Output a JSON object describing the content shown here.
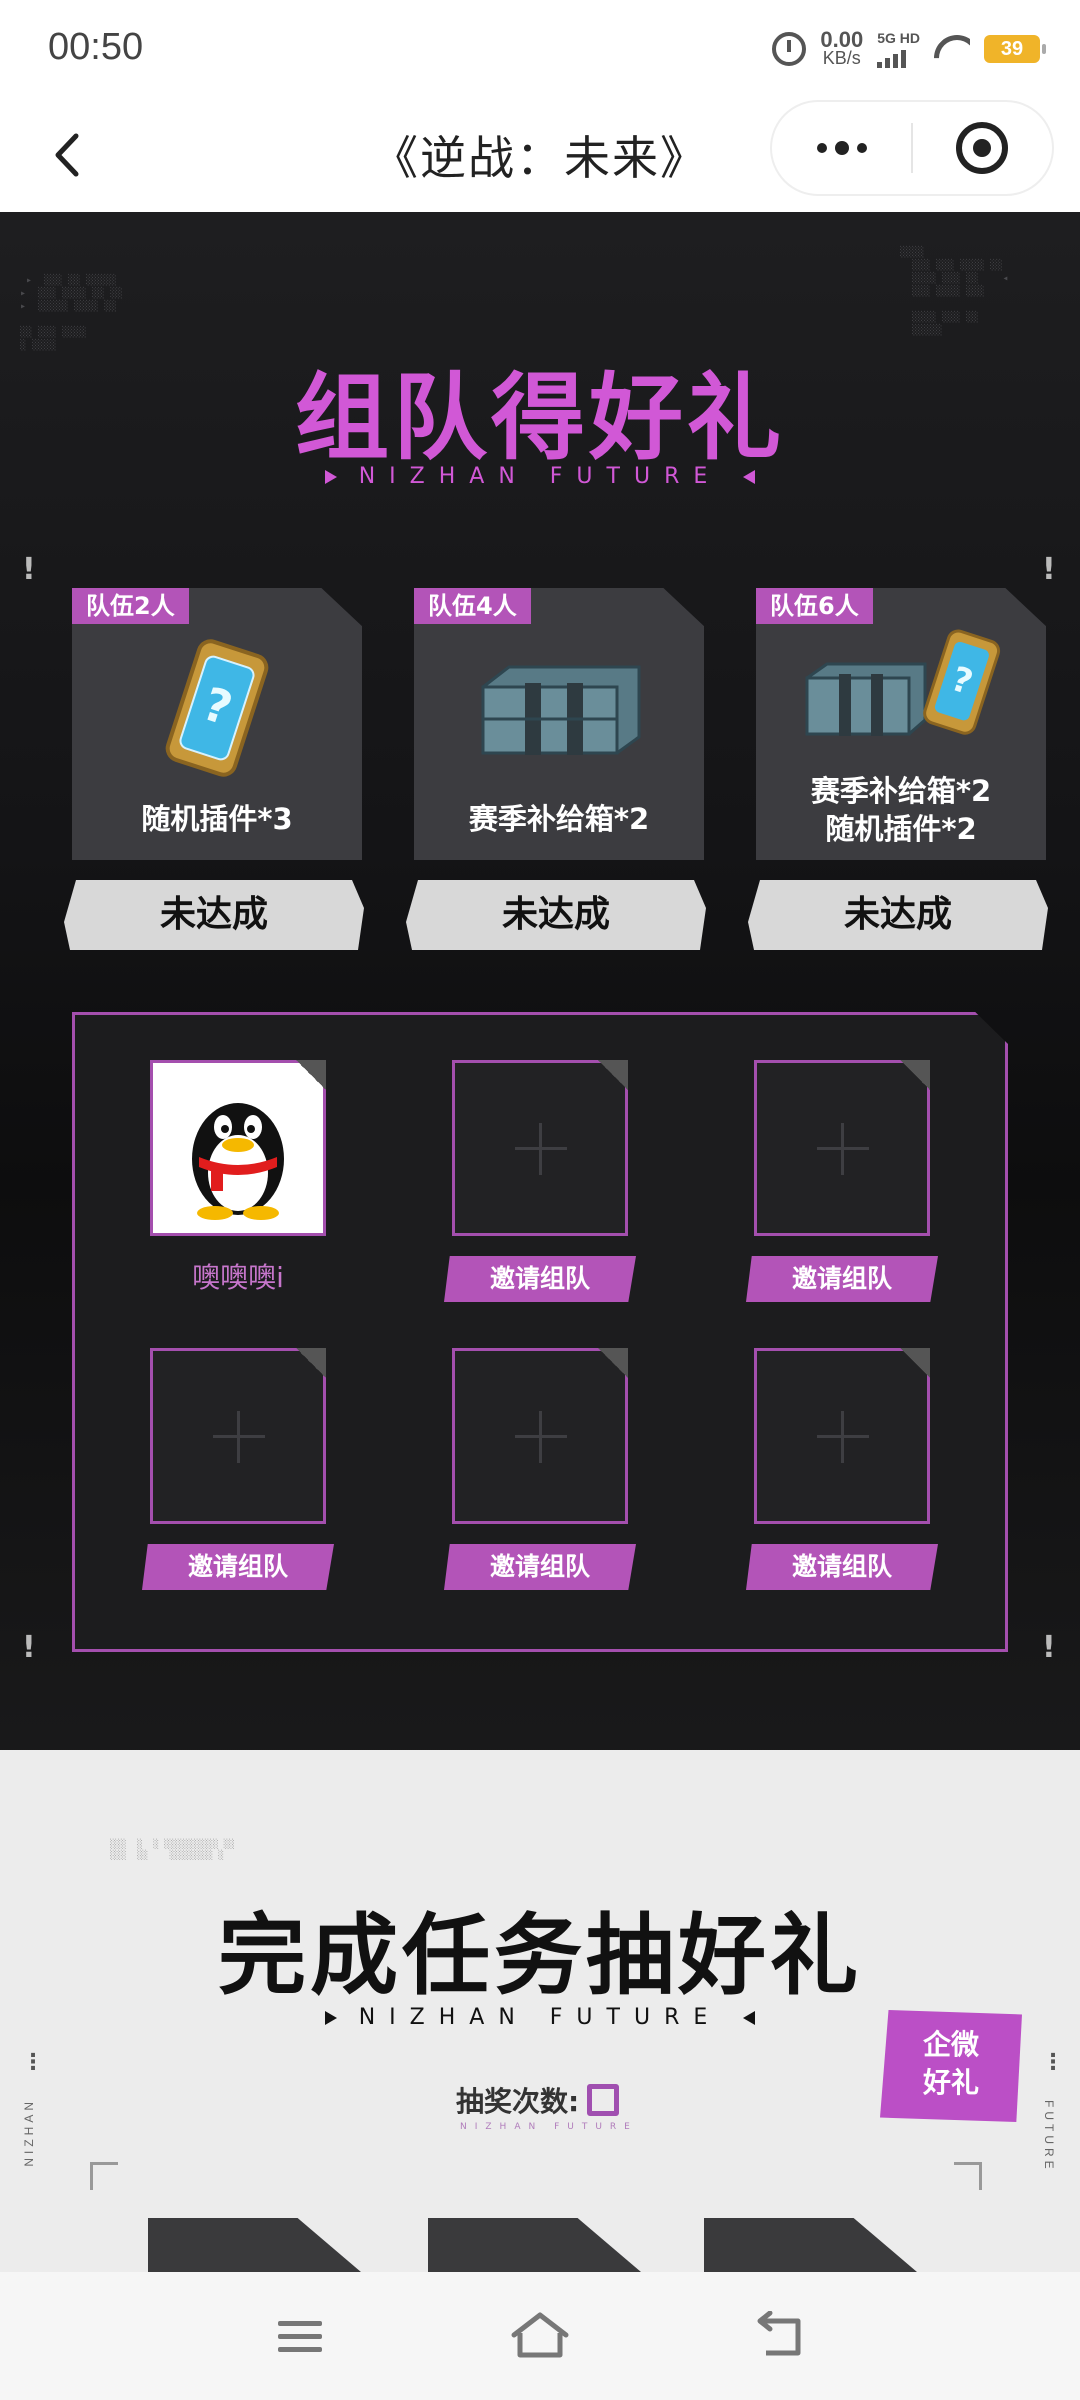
{
  "status_bar": {
    "time": "00:50",
    "net_speed_value": "0.00",
    "net_speed_unit": "KB/s",
    "signal_label": "5G HD",
    "battery": "39"
  },
  "header": {
    "title": "《逆战：未来》",
    "icons": [
      "back-icon",
      "more-icon",
      "close-miniprogram-icon"
    ]
  },
  "team_section": {
    "title": "组队得好礼",
    "subtitle": "NIZHAN FUTURE",
    "rewards": [
      {
        "tag": "队伍2人",
        "name_lines": [
          "随机插件*3"
        ],
        "status": "未达成"
      },
      {
        "tag": "队伍4人",
        "name_lines": [
          "赛季补给箱*2"
        ],
        "status": "未达成"
      },
      {
        "tag": "队伍6人",
        "name_lines": [
          "赛季补给箱*2",
          "随机插件*2"
        ],
        "status": "未达成"
      }
    ],
    "members": [
      {
        "name": "噢噢噢i"
      }
    ],
    "invite_label": "邀请组队"
  },
  "task_section": {
    "title": "完成任务抽好礼",
    "subtitle": "NIZHAN FUTURE",
    "draw_count_label": "抽奖次数:",
    "draw_count_sub": "NIZHAN FUTURE",
    "wecom_badge_line1": "企微",
    "wecom_badge_line2": "好礼",
    "side_left": "NIZHAN",
    "side_right": "FUTURE"
  },
  "bottom_nav": [
    "menu-icon",
    "home-icon",
    "back-icon"
  ],
  "colors": {
    "accent": "#d158d6",
    "accent_dark": "#a44fae",
    "dark_bg": "#141416",
    "light_bg": "#ececec"
  }
}
